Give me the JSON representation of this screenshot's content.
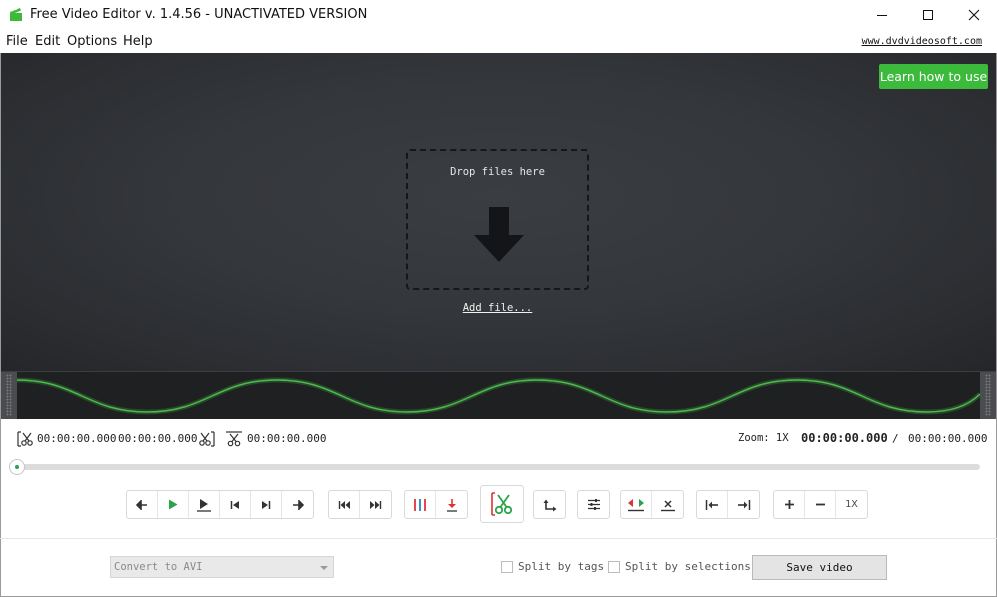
{
  "window": {
    "title": "Free Video Editor v. 1.4.56 - UNACTIVATED VERSION",
    "icons": {
      "app": "clapperboard-icon",
      "minimize": "minimize-icon",
      "maximize": "maximize-icon",
      "close": "close-icon"
    }
  },
  "menu": {
    "items": [
      "File",
      "Edit",
      "Options",
      "Help"
    ],
    "site_link": "www.dvdvideosoft.com"
  },
  "preview": {
    "learn_button": "Learn how to use",
    "drop_text": "Drop files here",
    "add_file": "Add file...",
    "colors": {
      "accent": "#3cba3c",
      "background": "#2c2e32",
      "wave": "#4fb84f"
    }
  },
  "timeline": {
    "selection_start": "00:00:00.000",
    "selection_end": "00:00:00.000",
    "cut_length": "00:00:00.000",
    "zoom_label": "Zoom: 1X",
    "current_time": "00:00:00.000",
    "separator": "/",
    "total_time": "00:00:00.000",
    "position_fraction": 0
  },
  "toolbar": {
    "zoom_reset": "1X"
  },
  "bottom": {
    "format_select": "Convert to AVI",
    "split_by_tags": "Split by tags",
    "split_by_selections": "Split by selections",
    "save_button": "Save video"
  }
}
